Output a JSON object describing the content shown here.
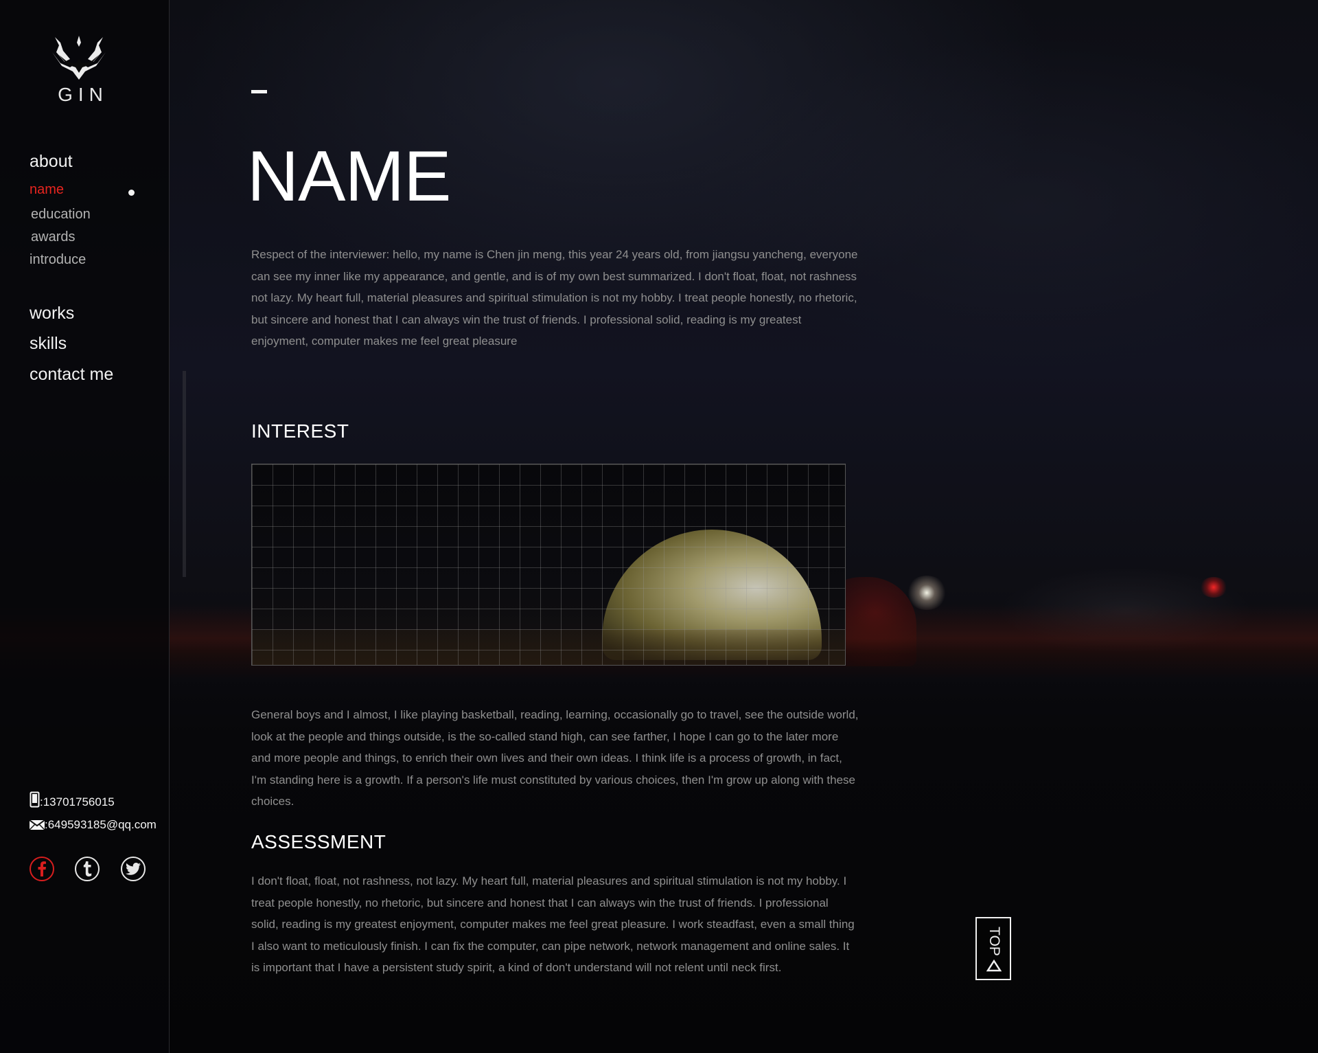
{
  "brand": {
    "logo_text": "GIN"
  },
  "nav": {
    "about": "about",
    "sub": {
      "name": "name",
      "education": "education",
      "awards": "awards",
      "introduce": "introduce"
    },
    "works": "works",
    "skills": "skills",
    "contact": "contact me",
    "active_item": "name",
    "active_color": "#e8251f"
  },
  "contact": {
    "phone": ":13701756015",
    "email": ":649593185@qq.com",
    "phone_icon": "phone-icon",
    "email_icon": "envelope-icon"
  },
  "social": [
    {
      "icon": "facebook-icon",
      "color": "#d71e1e"
    },
    {
      "icon": "tumblr-icon",
      "color": "#e6e6e6"
    },
    {
      "icon": "twitter-icon",
      "color": "#e6e6e6"
    }
  ],
  "main": {
    "title": "NAME",
    "intro": "Respect of the interviewer: hello, my name is Chen jin meng, this year 24 years old, from jiangsu yancheng, everyone can see my inner like my appearance, and gentle, and is of my own best summarized. I don't float, float, not rashness not lazy. My heart full, material pleasures and spiritual stimulation is not my hobby. I treat people honestly, no rhetoric, but sincere and honest that I can always win the trust of friends. I professional solid, reading is my greatest enjoyment, computer makes me feel great pleasure",
    "interest_title": "INTEREST",
    "interest_text": "General boys and I almost, I like playing basketball, reading, learning, occasionally go to travel, see the outside world, look at the people and things outside, is the so-called stand high, can see farther, I hope I can go to the later more and more people and things, to enrich their own lives and their own ideas. I think life is a process of growth, in fact, I'm standing here is a growth. If a person's life must constituted by various choices, then I'm grow up along with these choices.",
    "assessment_title": "ASSESSMENT",
    "assessment_text": "I don't float, float, not rashness, not lazy. My heart full, material pleasures and spiritual stimulation is not my hobby. I treat people honestly, no rhetoric, but sincere and honest that I can always win the trust of friends. I professional solid, reading is my greatest enjoyment, computer makes me feel great pleasure. I work steadfast, even a small thing I also want to meticulously finish. I can fix the computer, can pipe network, network management and online sales. It is important that I have a persistent study spirit, a kind of don't understand will not relent until neck first."
  },
  "top_button": {
    "label": "TOP",
    "icon": "triangle-up-icon"
  }
}
